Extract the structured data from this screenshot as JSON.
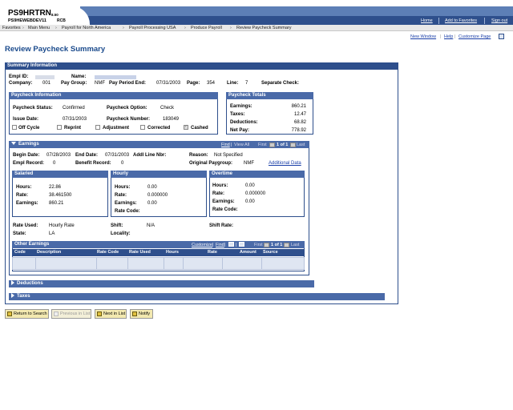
{
  "header": {
    "app_name": "PS9HRTRN",
    "version": "8.50",
    "db_name": "PS9HEWEBDEV11",
    "user_code": "RCB",
    "links": [
      "Home",
      "Add to Favorites",
      "Sign out"
    ]
  },
  "breadcrumb": [
    "Favorites",
    "Main Menu",
    "Payroll for North America",
    "Payroll Processing USA",
    "Produce Payroll",
    "Review Paycheck Summary"
  ],
  "page": {
    "title": "Review Paycheck Summary",
    "top_links": [
      "New Window",
      "Help",
      "Customize Page"
    ]
  },
  "summary": {
    "title": "Summary Information",
    "empl_id_label": "Empl ID:",
    "empl_id_value": "",
    "name_label": "Name:",
    "company_label": "Company:",
    "company_value": "001",
    "pay_group_label": "Pay Group:",
    "pay_group_value": "NMF",
    "pay_period_end_label": "Pay Period End:",
    "pay_period_end_value": "07/31/2003",
    "page_label": "Page:",
    "page_value": "354",
    "line_label": "Line:",
    "line_value": "7",
    "separate_check_label": "Separate Check:"
  },
  "paycheck_info": {
    "title": "Paycheck Information",
    "status_label": "Paycheck Status:",
    "status_value": "Confirmed",
    "option_label": "Paycheck Option:",
    "option_value": "Check",
    "issue_date_label": "Issue Date:",
    "issue_date_value": "07/31/2003",
    "number_label": "Paycheck Number:",
    "number_value": "183049",
    "checkboxes": [
      {
        "label": "Off Cycle",
        "checked": false
      },
      {
        "label": "Reprint",
        "checked": false
      },
      {
        "label": "Adjustment",
        "checked": false
      },
      {
        "label": "Corrected",
        "checked": false
      },
      {
        "label": "Cashed",
        "checked": true
      }
    ]
  },
  "paycheck_totals": {
    "title": "Paycheck Totals",
    "rows": [
      {
        "label": "Earnings:",
        "value": "860.21"
      },
      {
        "label": "Taxes:",
        "value": "12.47"
      },
      {
        "label": "Deductions:",
        "value": "68.82"
      },
      {
        "label": "Net Pay:",
        "value": "778.92"
      }
    ]
  },
  "earnings": {
    "title": "Earnings",
    "nav": {
      "find": "Find",
      "view_all": "View All",
      "range": "1 of 1",
      "first": "First",
      "last": "Last"
    },
    "begin_date_label": "Begin Date:",
    "begin_date_value": "07/28/2003",
    "end_date_label": "End Date:",
    "end_date_value": "07/31/2003",
    "addl_line_label": "Addl Line Nbr:",
    "reason_label": "Reason:",
    "reason_value": "Not Specified",
    "empl_record_label": "Empl Record:",
    "empl_record_value": "0",
    "benefit_record_label": "Benefit Record:",
    "benefit_record_value": "0",
    "orig_paygroup_label": "Original Paygroup:",
    "orig_paygroup_value": "NMF",
    "additional_data_link": "Additional Data",
    "salaried": {
      "title": "Salaried",
      "hours_label": "Hours:",
      "hours": "22.86",
      "rate_label": "Rate:",
      "rate": "38.461500",
      "earnings_label": "Earnings:",
      "earnings": "860.21"
    },
    "hourly": {
      "title": "Hourly",
      "hours_label": "Hours:",
      "hours": "0.00",
      "rate_label": "Rate:",
      "rate": "0.000000",
      "earnings_label": "Earnings:",
      "earnings": "0.00",
      "rate_code_label": "Rate Code:"
    },
    "overtime": {
      "title": "Overtime",
      "hours_label": "Hours:",
      "hours": "0.00",
      "rate_label": "Rate:",
      "rate": "0.000000",
      "earnings_label": "Earnings:",
      "earnings": "0.00",
      "rate_code_label": "Rate Code:"
    },
    "rate_used_label": "Rate Used:",
    "rate_used_value": "Hourly Rate",
    "shift_label": "Shift:",
    "shift_value": "N/A",
    "shift_rate_label": "Shift Rate:",
    "state_label": "State:",
    "state_value": "LA",
    "locality_label": "Locality:"
  },
  "other_earnings": {
    "title": "Other Earnings",
    "nav": {
      "customize": "Customize",
      "find": "Find",
      "range": "1 of 1",
      "first": "First",
      "last": "Last"
    },
    "columns": [
      "Code",
      "Description",
      "Rate Code",
      "Rate Used",
      "Hours",
      "Rate",
      "Amount",
      "Source"
    ]
  },
  "collapsed_sections": [
    "Deductions",
    "Taxes"
  ],
  "buttons": [
    {
      "label": "Return to Search",
      "enabled": true
    },
    {
      "label": "Previous in List",
      "enabled": false
    },
    {
      "label": "Next in List",
      "enabled": true
    },
    {
      "label": "Notify",
      "enabled": true
    }
  ],
  "colors": {
    "brand_dark": "#2e4f8c",
    "brand_light": "#5d7fb6",
    "title": "#1a4a8c"
  }
}
